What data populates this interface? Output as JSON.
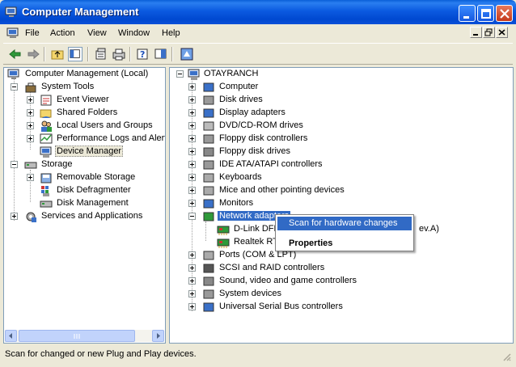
{
  "window": {
    "title": "Computer Management",
    "controls": {
      "minimize": "minimize",
      "maximize": "maximize",
      "close": "close"
    }
  },
  "menu": {
    "items": [
      "File",
      "Action",
      "View",
      "Window",
      "Help"
    ]
  },
  "toolbar": {
    "buttons": [
      "back-arrow-icon",
      "forward-arrow-icon",
      "up-folder-icon",
      "show-hide-tree-icon",
      "properties-icon",
      "print-icon",
      "help-icon",
      "help-topics-icon",
      "scan-hardware-icon"
    ]
  },
  "left_tree": {
    "root": "Computer Management (Local)",
    "system_tools": "System Tools",
    "event_viewer": "Event Viewer",
    "shared_folders": "Shared Folders",
    "local_users": "Local Users and Groups",
    "perf_logs": "Performance Logs and Alerts",
    "device_manager": "Device Manager",
    "storage": "Storage",
    "removable_storage": "Removable Storage",
    "disk_defrag": "Disk Defragmenter",
    "disk_management": "Disk Management",
    "services": "Services and Applications"
  },
  "right_tree": {
    "root": "OTAYRANCH",
    "categories": [
      "Computer",
      "Disk drives",
      "Display adapters",
      "DVD/CD-ROM drives",
      "Floppy disk controllers",
      "Floppy disk drives",
      "IDE ATA/ATAPI controllers",
      "Keyboards",
      "Mice and other pointing devices",
      "Monitors",
      "Network adapters"
    ],
    "network_children": [
      {
        "label": "D-Link DFE",
        "suffix": "ev.A)"
      },
      {
        "label": "Realtek RT",
        "suffix": ""
      }
    ],
    "after": [
      "Ports (COM & LPT)",
      "SCSI and RAID controllers",
      "Sound, video and game controllers",
      "System devices",
      "Universal Serial Bus controllers"
    ]
  },
  "context_menu": {
    "scan": "Scan for hardware changes",
    "properties": "Properties"
  },
  "status": {
    "text": "Scan for changed or new Plug and Play devices."
  },
  "colors": {
    "titlebar": "#0054e3",
    "selection": "#316ac5",
    "window_bg": "#ece9d8"
  }
}
